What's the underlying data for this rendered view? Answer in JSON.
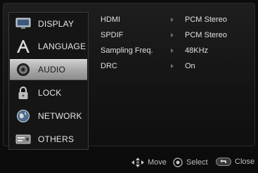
{
  "menu": {
    "items": [
      {
        "label": "DISPLAY",
        "icon": "display-icon"
      },
      {
        "label": "LANGUAGE",
        "icon": "language-icon"
      },
      {
        "label": "AUDIO",
        "icon": "audio-icon"
      },
      {
        "label": "LOCK",
        "icon": "lock-icon"
      },
      {
        "label": "NETWORK",
        "icon": "network-icon"
      },
      {
        "label": "OTHERS",
        "icon": "others-icon"
      }
    ],
    "selected": "AUDIO"
  },
  "settings": [
    {
      "name": "HDMI",
      "value": "PCM Stereo"
    },
    {
      "name": "SPDIF",
      "value": "PCM Stereo"
    },
    {
      "name": "Sampling Freq.",
      "value": "48KHz"
    },
    {
      "name": "DRC",
      "value": "On"
    }
  ],
  "footer": {
    "move": "Move",
    "select": "Select",
    "close": "Close"
  },
  "colors": {
    "background": "#0c0c0c",
    "selected_item": "#b5b5b5",
    "text": "#e0e0e0"
  }
}
